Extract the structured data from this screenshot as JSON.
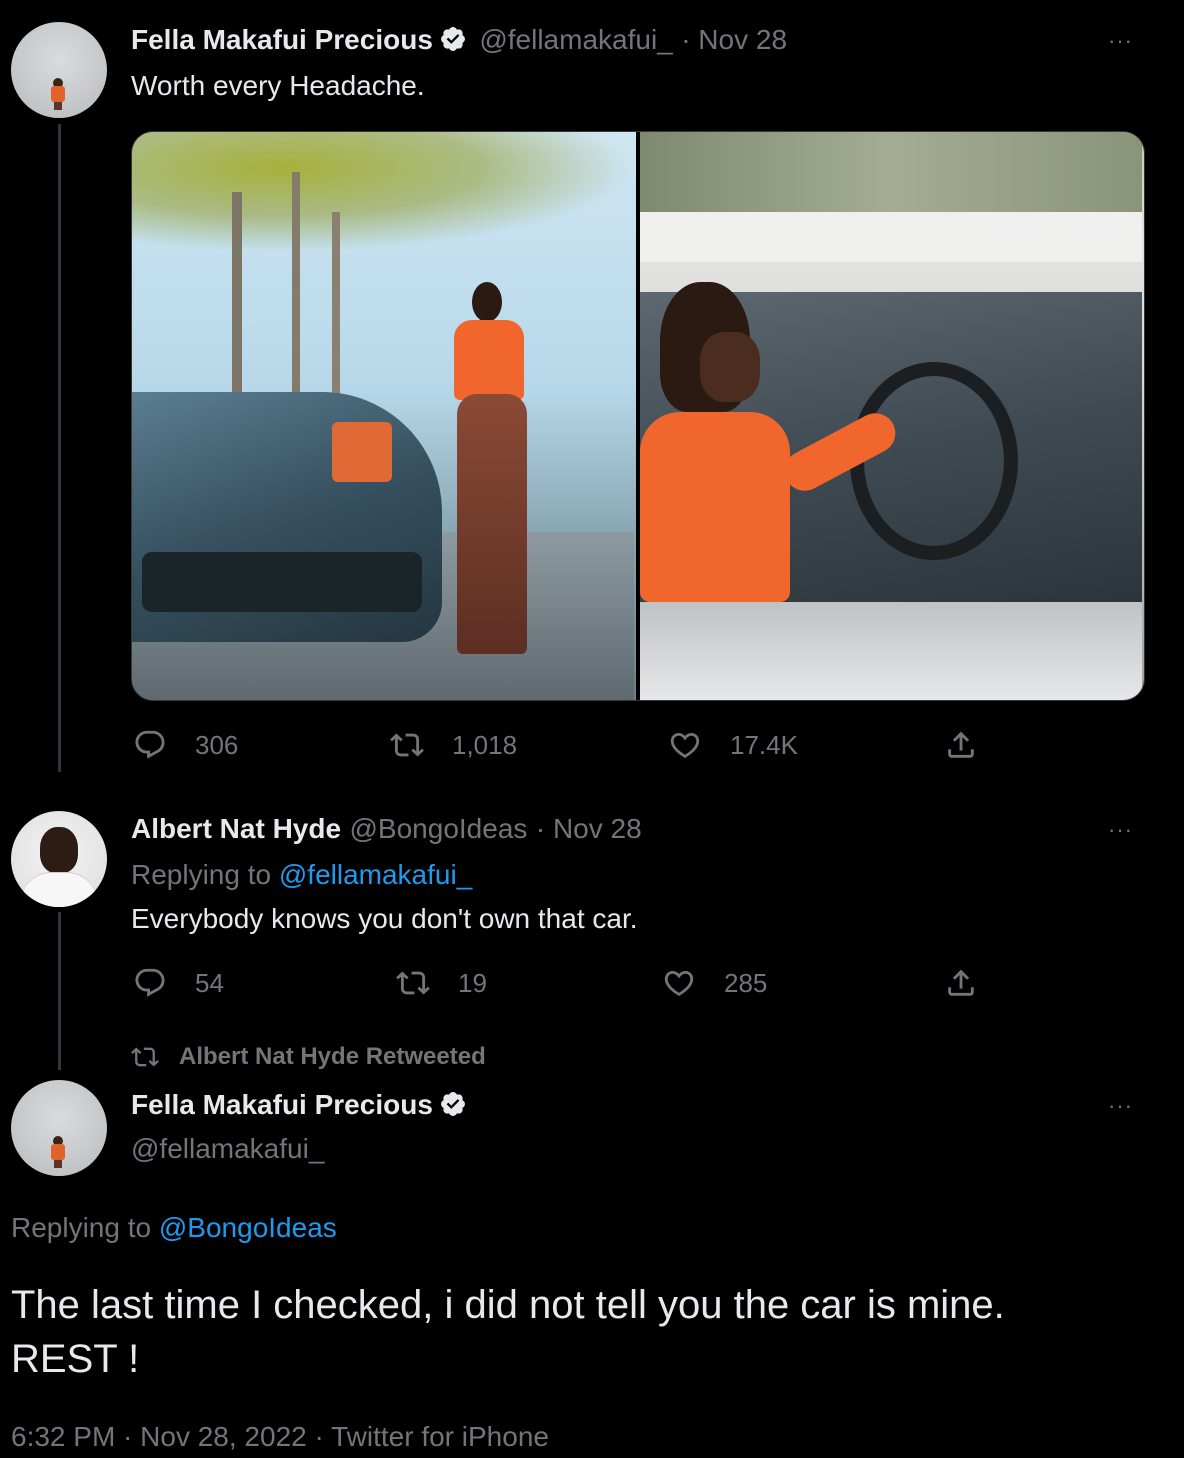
{
  "tweet1": {
    "name": "Fella Makafui Precious",
    "handle": "@fellamakafui_",
    "date": "· Nov 28",
    "more": "···",
    "text": "Worth every Headache.",
    "replies": "306",
    "retweets": "1,018",
    "likes": "17.4K",
    "images": [
      "photo-woman-standing-by-sports-car",
      "photo-woman-in-convertible"
    ]
  },
  "tweet2": {
    "name": "Albert Nat Hyde",
    "handle": "@BongoIdeas",
    "date": "· Nov 28",
    "more": "···",
    "replying_prefix": "Replying to",
    "replying_to": "@fellamakafui_",
    "text": "Everybody knows you don't own that car.",
    "replies": "54",
    "retweets": "19",
    "likes": "285"
  },
  "retweet_banner": "Albert Nat Hyde Retweeted",
  "tweet3": {
    "name": "Fella Makafui Precious",
    "handle": "@fellamakafui_",
    "more": "···",
    "replying_prefix": "Replying to",
    "replying_to": "@BongoIdeas",
    "text_line1": "The last time I checked, i did not tell you the car is mine.",
    "text_line2": "REST !",
    "meta": "6:32 PM · Nov 28, 2022 · Twitter for iPhone"
  },
  "colors": {
    "background": "#000000",
    "text": "#e7e9ea",
    "muted": "#71767b",
    "link": "#1d9bf0",
    "verified": "#e7e9ea"
  }
}
